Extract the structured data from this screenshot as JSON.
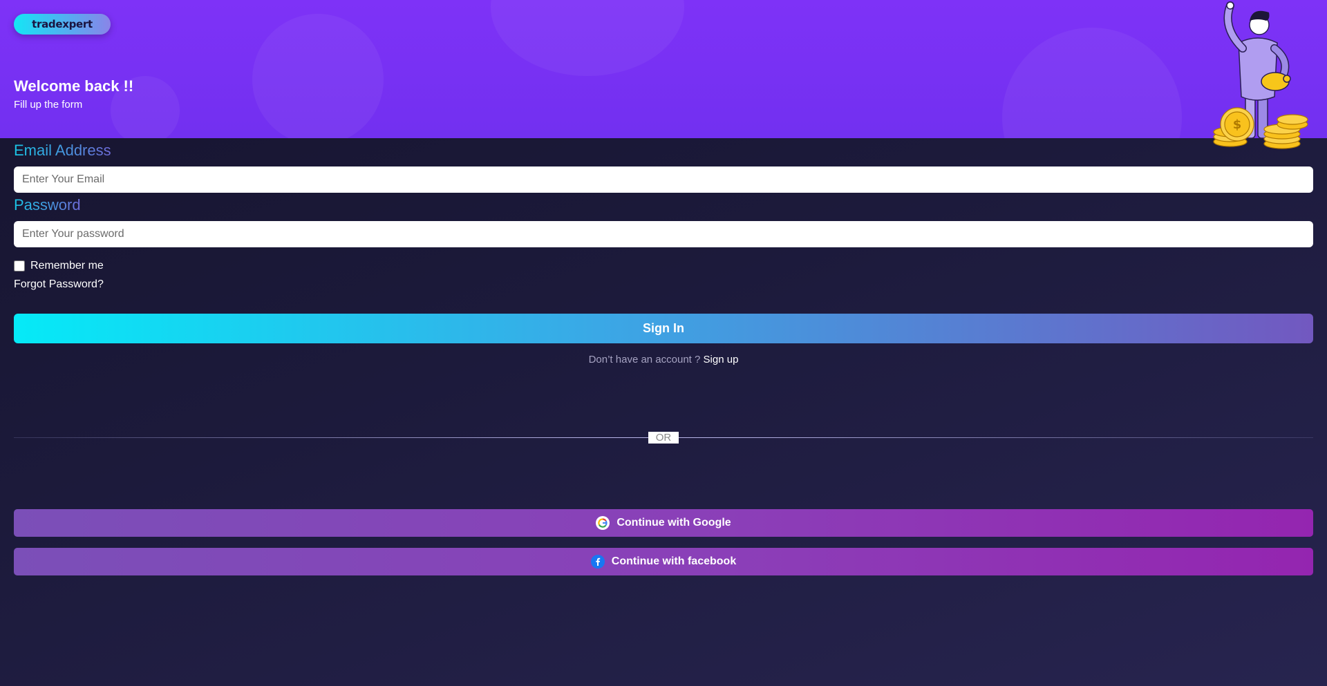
{
  "brand": {
    "logo_text": "tradexpert"
  },
  "header": {
    "title": "Welcome back !!",
    "subtitle": "Fill up the form"
  },
  "form": {
    "email_label": "Email Address",
    "email_placeholder": "Enter Your Email",
    "password_label": "Password",
    "password_placeholder": "Enter Your password",
    "remember_label": "Remember me",
    "remember_checked": false,
    "forgot_label": "Forgot Password?",
    "signin_label": "Sign In"
  },
  "signup": {
    "prompt": "Don’t have an account ?",
    "link_label": "Sign up"
  },
  "divider": {
    "label": "OR"
  },
  "social": {
    "google_label": "Continue with Google",
    "google_icon": "google-icon",
    "facebook_label": "Continue with facebook",
    "facebook_icon": "facebook-icon"
  },
  "colors": {
    "header_bg": "#7e32f7",
    "page_bg": "#1c1a3b",
    "signin_gradient_start": "#05eaf7",
    "signin_gradient_end": "#7258c0",
    "social_gradient_start": "#7b4fb8",
    "social_gradient_end": "#9425b0"
  }
}
